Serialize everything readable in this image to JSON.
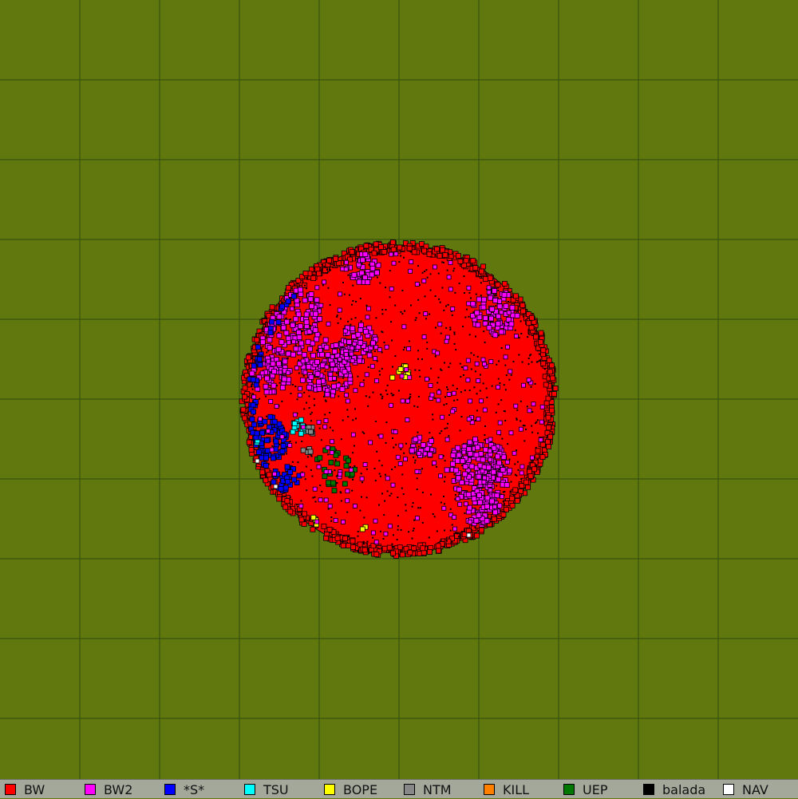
{
  "map": {
    "background_color": "#61780f",
    "grid_color": "#2f4a0e",
    "grid_cells_per_side": 10
  },
  "legend": {
    "items": [
      {
        "label": "BW",
        "color": "#ff0000"
      },
      {
        "label": "BW2",
        "color": "#ff00ff"
      },
      {
        "label": "*S*",
        "color": "#0000ff"
      },
      {
        "label": "TSU",
        "color": "#00ffff"
      },
      {
        "label": "BOPE",
        "color": "#ffff00"
      },
      {
        "label": "NTM",
        "color": "#888888"
      },
      {
        "label": "KILL",
        "color": "#ff8000"
      },
      {
        "label": "UEP",
        "color": "#007700"
      },
      {
        "label": "balada",
        "color": "#000000"
      },
      {
        "label": "NAV",
        "color": "#ffffff"
      }
    ]
  }
}
